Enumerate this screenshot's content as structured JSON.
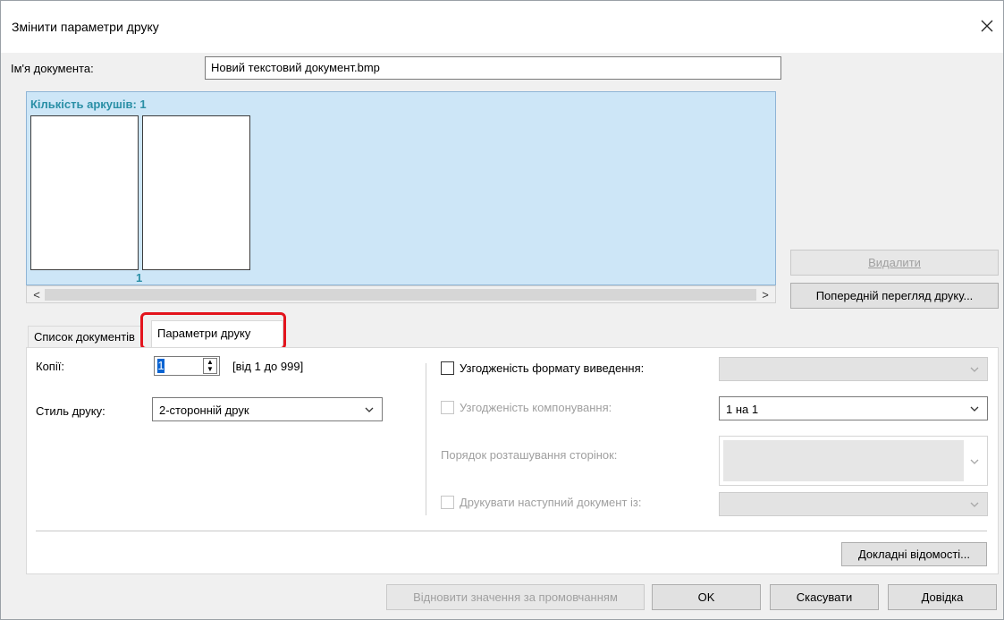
{
  "window": {
    "title": "Змінити параметри друку"
  },
  "document": {
    "name_label": "Ім'я документа:",
    "name_value": "Новий текстовий документ.bmp"
  },
  "preview": {
    "sheet_count": "Кількість аркушів: 1",
    "page_number": "1",
    "scroll_left": "<",
    "scroll_right": ">"
  },
  "side_buttons": {
    "delete": "Видалити",
    "print_preview": "Попередній перегляд друку..."
  },
  "tabs": [
    {
      "label": "Список документів",
      "active": false
    },
    {
      "label": "Параметри друку",
      "active": true
    }
  ],
  "settings": {
    "copies_label": "Копії:",
    "copies_value": "1",
    "copies_range": "[від 1 до 999]",
    "print_style_label": "Стиль друку:",
    "print_style_value": "2-сторонній друк",
    "output_format_match": {
      "label": "Узгодженість формату виведення:",
      "checked": false,
      "enabled": true,
      "value": ""
    },
    "layout_match": {
      "label": "Узгодженість компонування:",
      "checked": false,
      "enabled": false,
      "value": "1 на 1"
    },
    "page_order_label": "Порядок розташування сторінок:",
    "print_next": {
      "label": "Друкувати наступний документ із:",
      "checked": false,
      "enabled": false,
      "value": ""
    },
    "details_button": "Докладні відомості..."
  },
  "footer": {
    "restore_defaults": "Відновити значення за промовчанням",
    "ok": "OK",
    "cancel": "Скасувати",
    "help": "Довідка"
  },
  "colors": {
    "preview_bg": "#cde6f7",
    "accent_text": "#2a8fa6",
    "highlight": "#e3141d"
  }
}
